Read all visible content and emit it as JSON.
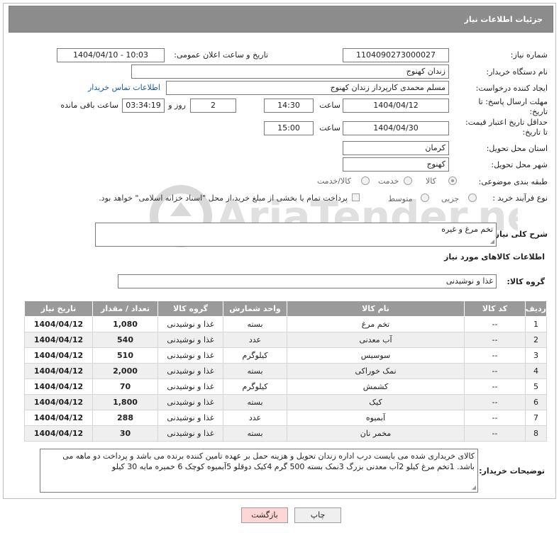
{
  "header": {
    "title": "جزئیات اطلاعات نیاز"
  },
  "form": {
    "need_number_label": "شماره نیاز:",
    "need_number": "1104090273000027",
    "announce_label": "تاریخ و ساعت اعلان عمومی:",
    "announce_value": "1404/04/10 - 10:03",
    "buyer_org_label": "نام دستگاه خریدار:",
    "buyer_org": "زندان کهنوج",
    "creator_label": "ایجاد کننده درخواست:",
    "creator": "مسلم محمدی کارپرداز زندان کهنوج",
    "contact_link": "اطلاعات تماس خریدار",
    "deadline_label_1": "مهلت ارسال پاسخ: تا",
    "deadline_label_2": "تاریخ:",
    "deadline_date": "1404/04/12",
    "time_label": "ساعت",
    "deadline_time": "14:30",
    "days_value": "2",
    "days_label": "روز و",
    "remaining_time": "03:34:19",
    "remaining_label": "ساعت باقی مانده",
    "validity_label_1": "حداقل تاریخ اعتبار قیمت:",
    "validity_label_2": "تا تاریخ:",
    "validity_date": "1404/04/30",
    "validity_time": "15:00",
    "province_label": "استان محل تحویل:",
    "province": "کرمان",
    "city_label": "شهر محل تحویل:",
    "city": "کهنوج",
    "category_label": "طبقه بندی موضوعی:",
    "category_options": [
      "کالا",
      "خدمت",
      "کالا/خدمت"
    ],
    "category_selected": "کالا",
    "process_label": "نوع فرآیند خرید :",
    "process_options": [
      "جزیی",
      "متوسط"
    ],
    "payment_note": "پرداخت تمام یا بخشی از مبلغ خرید،از محل \"اسناد خزانه اسلامی\" خواهد بود."
  },
  "description": {
    "label": "شرح کلی نیاز:",
    "value": "تخم مرغ و غیره"
  },
  "goods": {
    "section_title": "اطلاعات کالاهای مورد نیاز",
    "group_label": "گروه کالا:",
    "group_value": "غذا و نوشیدنی",
    "columns": [
      "ردیف",
      "کد کالا",
      "نام کالا",
      "واحد شمارش",
      "گروه کالا",
      "تعداد / مقدار",
      "تاریخ نیاز"
    ],
    "rows": [
      [
        "1",
        "--",
        "تخم مرغ",
        "بسته",
        "غذا و نوشیدنی",
        "1,080",
        "1404/04/12"
      ],
      [
        "2",
        "--",
        "آب معدنی",
        "عدد",
        "غذا و نوشیدنی",
        "540",
        "1404/04/12"
      ],
      [
        "3",
        "--",
        "سوسیس",
        "کیلوگرم",
        "غذا و نوشیدنی",
        "510",
        "1404/04/12"
      ],
      [
        "4",
        "--",
        "نمک خوراکی",
        "بسته",
        "غذا و نوشیدنی",
        "2,000",
        "1404/04/12"
      ],
      [
        "5",
        "--",
        "کشمش",
        "کیلوگرم",
        "غذا و نوشیدنی",
        "70",
        "1404/04/12"
      ],
      [
        "6",
        "--",
        "کیک",
        "بسته",
        "غذا و نوشیدنی",
        "1,800",
        "1404/04/12"
      ],
      [
        "7",
        "--",
        "آبمیوه",
        "عدد",
        "غذا و نوشیدنی",
        "288",
        "1404/04/12"
      ],
      [
        "8",
        "--",
        "مخمر نان",
        "بسته",
        "غذا و نوشیدنی",
        "30",
        "1404/04/12"
      ]
    ]
  },
  "buyer_notes": {
    "label": "توضیحات خریدار:",
    "value": "کالای خریداری شده می بایست درب اداره زندان تحویل و هزینه حمل بر عهده تامین کننده برنده می باشد و پرداخت دو ماهه می باشد. 1تخم مرغ کیلو 2آب معدنی بزرگ 3نمک بسته 500 گرم 4کیک دوقلو 5آبمیوه کوچک 6 خمیره مایه 30 کیلو"
  },
  "buttons": {
    "print": "چاپ",
    "back": "بازگشت"
  },
  "watermark_text": "AriaTender.neT"
}
